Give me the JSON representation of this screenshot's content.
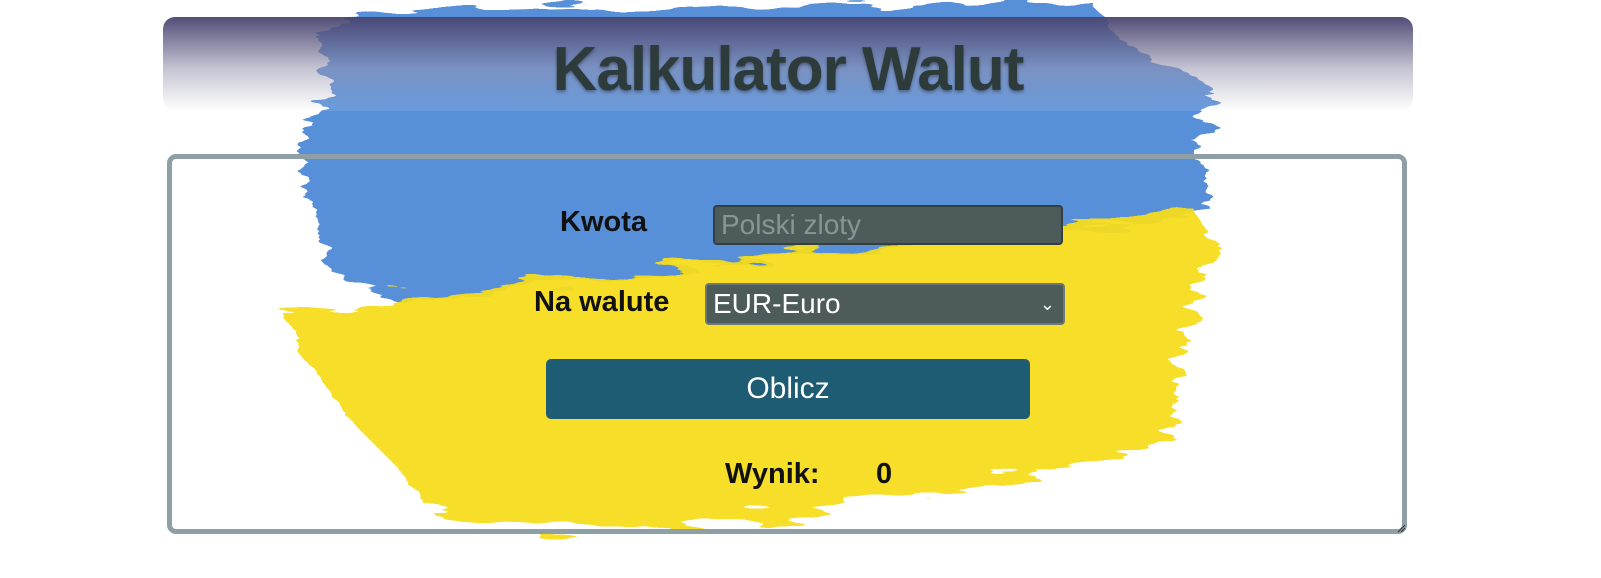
{
  "header": {
    "title": "Kalkulator Walut"
  },
  "form": {
    "amount_label": "Kwota",
    "amount_placeholder": "Polski zloty",
    "amount_value": "",
    "currency_label": "Na walute",
    "currency_selected": "EUR-Euro",
    "submit_label": "Oblicz",
    "result_label": "Wynik:",
    "result_value": "0"
  },
  "colors": {
    "flag_blue": "#4a86d6",
    "flag_yellow": "#f5dc1e",
    "button": "#1e5c73",
    "field_bg": "#4e5b5b",
    "panel_border": "#8ea0a6"
  },
  "icons": {
    "select_arrow": "chevron-down-icon"
  }
}
